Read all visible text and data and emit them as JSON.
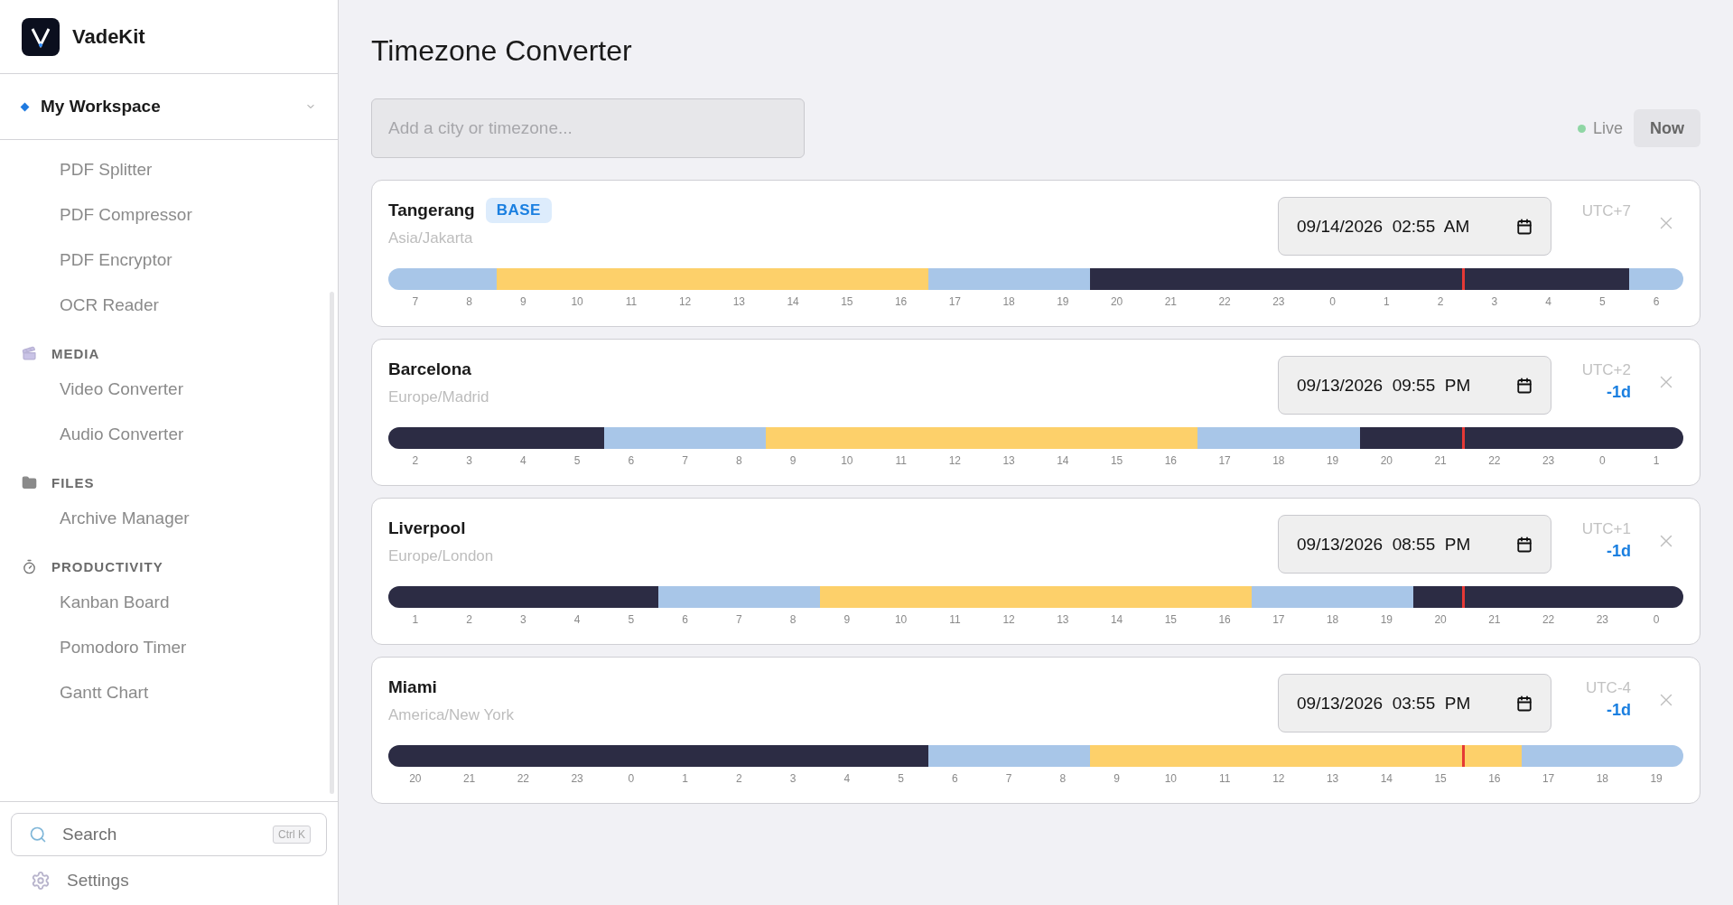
{
  "sidebar": {
    "brand": "VadeKit",
    "workspace": "My Workspace",
    "sections": [
      {
        "items": [
          "PDF Splitter",
          "PDF Compressor",
          "PDF Encryptor",
          "OCR Reader"
        ]
      },
      {
        "kind": "media",
        "title": "MEDIA",
        "items": [
          "Video Converter",
          "Audio Converter"
        ]
      },
      {
        "kind": "files",
        "title": "FILES",
        "items": [
          "Archive Manager"
        ]
      },
      {
        "kind": "productivity",
        "title": "PRODUCTIVITY",
        "items": [
          "Kanban Board",
          "Pomodoro Timer",
          "Gantt Chart"
        ]
      }
    ],
    "search": {
      "placeholder": "Search",
      "shortcut": "Ctrl K"
    },
    "settings": "Settings"
  },
  "page": {
    "title": "Timezone Converter",
    "add_field": {
      "placeholder": "Add a city or timezone..."
    },
    "live": "Live",
    "now_button": "Now"
  },
  "cities": [
    {
      "name": "Tangerang",
      "badge": "BASE",
      "zone": "Asia/Jakarta",
      "datetime": "09/14/2026  02:55  AM",
      "utc": "UTC+7",
      "level": 0.83,
      "hours": [
        {
          "label": "7",
          "kind": "twilight"
        },
        {
          "label": "8",
          "kind": "twilight"
        },
        {
          "label": "9",
          "kind": "day"
        },
        {
          "label": "10",
          "kind": "day"
        },
        {
          "label": "11",
          "kind": "day"
        },
        {
          "label": "12",
          "kind": "day"
        },
        {
          "label": "13",
          "kind": "day"
        },
        {
          "label": "14",
          "kind": "day"
        },
        {
          "label": "15",
          "kind": "day"
        },
        {
          "label": "16",
          "kind": "day"
        },
        {
          "label": "17",
          "kind": "twilight"
        },
        {
          "label": "18",
          "kind": "twilight"
        },
        {
          "label": "19",
          "kind": "twilight"
        },
        {
          "label": "20",
          "kind": "night"
        },
        {
          "label": "21",
          "kind": "night"
        },
        {
          "label": "22",
          "kind": "night"
        },
        {
          "label": "23",
          "kind": "night"
        },
        {
          "label": "0",
          "kind": "night"
        },
        {
          "label": "1",
          "kind": "night"
        },
        {
          "label": "2",
          "kind": "night"
        },
        {
          "label": "3",
          "kind": "night"
        },
        {
          "label": "4",
          "kind": "night"
        },
        {
          "label": "5",
          "kind": "night"
        },
        {
          "label": "6",
          "kind": "twilight"
        }
      ]
    },
    {
      "name": "Barcelona",
      "zone": "Europe/Madrid",
      "datetime": "09/13/2026  09:55  PM",
      "utc": "UTC+2",
      "day_offset": "-1d",
      "level": 0.83,
      "hours": [
        {
          "label": "2",
          "kind": "night"
        },
        {
          "label": "3",
          "kind": "night"
        },
        {
          "label": "4",
          "kind": "night"
        },
        {
          "label": "5",
          "kind": "night"
        },
        {
          "label": "6",
          "kind": "twilight"
        },
        {
          "label": "7",
          "kind": "twilight"
        },
        {
          "label": "8",
          "kind": "twilight"
        },
        {
          "label": "9",
          "kind": "day"
        },
        {
          "label": "10",
          "kind": "day"
        },
        {
          "label": "11",
          "kind": "day"
        },
        {
          "label": "12",
          "kind": "day"
        },
        {
          "label": "13",
          "kind": "day"
        },
        {
          "label": "14",
          "kind": "day"
        },
        {
          "label": "15",
          "kind": "day"
        },
        {
          "label": "16",
          "kind": "day"
        },
        {
          "label": "17",
          "kind": "twilight"
        },
        {
          "label": "18",
          "kind": "twilight"
        },
        {
          "label": "19",
          "kind": "twilight"
        },
        {
          "label": "20",
          "kind": "night"
        },
        {
          "label": "21",
          "kind": "night"
        },
        {
          "label": "22",
          "kind": "night"
        },
        {
          "label": "23",
          "kind": "night"
        },
        {
          "label": "0",
          "kind": "night"
        },
        {
          "label": "1",
          "kind": "night"
        }
      ]
    },
    {
      "name": "Liverpool",
      "zone": "Europe/London",
      "datetime": "09/13/2026  08:55  PM",
      "utc": "UTC+1",
      "day_offset": "-1d",
      "level": 0.83,
      "hours": [
        {
          "label": "1",
          "kind": "night"
        },
        {
          "label": "2",
          "kind": "night"
        },
        {
          "label": "3",
          "kind": "night"
        },
        {
          "label": "4",
          "kind": "night"
        },
        {
          "label": "5",
          "kind": "night"
        },
        {
          "label": "6",
          "kind": "twilight"
        },
        {
          "label": "7",
          "kind": "twilight"
        },
        {
          "label": "8",
          "kind": "twilight"
        },
        {
          "label": "9",
          "kind": "day"
        },
        {
          "label": "10",
          "kind": "day"
        },
        {
          "label": "11",
          "kind": "day"
        },
        {
          "label": "12",
          "kind": "day"
        },
        {
          "label": "13",
          "kind": "day"
        },
        {
          "label": "14",
          "kind": "day"
        },
        {
          "label": "15",
          "kind": "day"
        },
        {
          "label": "16",
          "kind": "day"
        },
        {
          "label": "17",
          "kind": "twilight"
        },
        {
          "label": "18",
          "kind": "twilight"
        },
        {
          "label": "19",
          "kind": "twilight"
        },
        {
          "label": "20",
          "kind": "night"
        },
        {
          "label": "21",
          "kind": "night"
        },
        {
          "label": "22",
          "kind": "night"
        },
        {
          "label": "23",
          "kind": "night"
        },
        {
          "label": "0",
          "kind": "night"
        }
      ]
    },
    {
      "name": "Miami",
      "zone": "America/New York",
      "datetime": "09/13/2026  03:55  PM",
      "utc": "UTC-4",
      "day_offset": "-1d",
      "level": 0.83,
      "hours": [
        {
          "label": "20",
          "kind": "night"
        },
        {
          "label": "21",
          "kind": "night"
        },
        {
          "label": "22",
          "kind": "night"
        },
        {
          "label": "23",
          "kind": "night"
        },
        {
          "label": "0",
          "kind": "night"
        },
        {
          "label": "1",
          "kind": "night"
        },
        {
          "label": "2",
          "kind": "night"
        },
        {
          "label": "3",
          "kind": "night"
        },
        {
          "label": "4",
          "kind": "night"
        },
        {
          "label": "5",
          "kind": "night"
        },
        {
          "label": "6",
          "kind": "twilight"
        },
        {
          "label": "7",
          "kind": "twilight"
        },
        {
          "label": "8",
          "kind": "twilight"
        },
        {
          "label": "9",
          "kind": "day"
        },
        {
          "label": "10",
          "kind": "day"
        },
        {
          "label": "11",
          "kind": "day"
        },
        {
          "label": "12",
          "kind": "day"
        },
        {
          "label": "13",
          "kind": "day"
        },
        {
          "label": "14",
          "kind": "day"
        },
        {
          "label": "15",
          "kind": "day"
        },
        {
          "label": "16",
          "kind": "day"
        },
        {
          "label": "17",
          "kind": "twilight"
        },
        {
          "label": "18",
          "kind": "twilight"
        },
        {
          "label": "19",
          "kind": "twilight"
        }
      ]
    }
  ]
}
